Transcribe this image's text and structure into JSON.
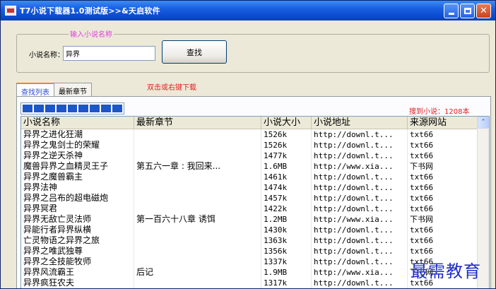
{
  "window": {
    "title": "T7小说下载器1.0测试版>>&天启软件",
    "buttons": {
      "minimize": "minimize",
      "maximize": "maximize",
      "close": "✕"
    }
  },
  "search": {
    "caption": "输入小说名称",
    "label": "小说名称：",
    "value": "异界",
    "button": "查找"
  },
  "tabs": [
    {
      "label": "查找列表",
      "active": true
    },
    {
      "label": "最新章节",
      "active": false
    }
  ],
  "hint": "双击或右键下载",
  "progress": {
    "segments": 9
  },
  "count_text": "搜到小说：1208本",
  "table": {
    "columns": [
      "小说名称",
      "最新章节",
      "小说大小",
      "小说地址",
      "来源网站"
    ],
    "rows": [
      [
        "异界之进化狂潮",
        "",
        "1526k",
        "http://downl.t...",
        "txt66"
      ],
      [
        "异界之鬼剑士的荣耀",
        "",
        "1526k",
        "http://downl.t...",
        "txt66"
      ],
      [
        "异界之逆天杀神",
        "",
        "1477k",
        "http://downl.t...",
        "txt66"
      ],
      [
        "魔兽异界之血精灵王子",
        "第五六一章 : 我回来...",
        "1.6MB",
        "http://www.xia...",
        "下书网"
      ],
      [
        "异界之魔兽霸主",
        "",
        "1461k",
        "http://downl.t...",
        "txt66"
      ],
      [
        "异界法神",
        "",
        "1474k",
        "http://downl.t...",
        "txt66"
      ],
      [
        "异界之吕布的超电磁炮",
        "",
        "1457k",
        "http://downl.t...",
        "txt66"
      ],
      [
        "异界冥君",
        "",
        "1422k",
        "http://downl.t...",
        "txt66"
      ],
      [
        "异界无敌亡灵法师",
        "第一百六十八章 诱饵",
        "1.2MB",
        "http://www.xia...",
        "下书网"
      ],
      [
        "异能行者异界纵横",
        "",
        "1430k",
        "http://downl.t...",
        "txt66"
      ],
      [
        "亡灵物语之异界之旅",
        "",
        "1363k",
        "http://downl.t...",
        "txt66"
      ],
      [
        "异界之唯武独尊",
        "",
        "1356k",
        "http://downl.t...",
        "txt66"
      ],
      [
        "异界之全技能牧师",
        "",
        "1337k",
        "http://downl.t...",
        "txt66"
      ],
      [
        "异界风流霸王",
        "后记",
        "1.9MB",
        "http://www.xia...",
        "下书网"
      ],
      [
        "异界疯狂农夫",
        "",
        "1317k",
        "http://downl.t...",
        "txt66"
      ]
    ]
  },
  "scrollbar": {
    "up": "⌃"
  },
  "watermark": "最需教育"
}
